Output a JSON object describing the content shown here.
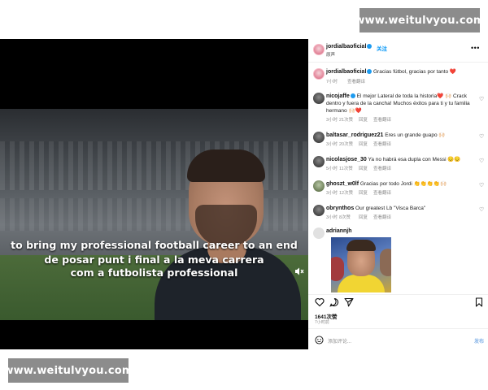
{
  "watermark": {
    "text": "www.weitulvyou.com"
  },
  "video": {
    "subtitle_en": "to bring my professional football career to an end",
    "subtitle_ca_1": "de posar punt i final a la meva carrera",
    "subtitle_ca_2": "com a futbolista professional"
  },
  "post": {
    "author": "jordialbaoficial",
    "follow_label": "关注",
    "header_subtitle": "原声",
    "caption": "Gracias fútbol, gracias por tanto ❤️",
    "caption_time": "7小时",
    "caption_translate": "查看翻译",
    "comments": [
      {
        "user": "nicojaffe",
        "text": "El mejor Lateral de toda la historia❤️ 🙌🏻 Crack dentro y fuera de la cancha! Muchos éxitos para ti y tu familia hermano 🙌🏻❤️",
        "time": "3小时",
        "likes": "21次赞",
        "reply": "回复",
        "translate": "查看翻译"
      },
      {
        "user": "baltasar_rodriguez21",
        "text": "Eres un grande guapo 🙌🏻",
        "time": "3小时",
        "likes": "20次赞",
        "reply": "回复",
        "translate": "查看翻译"
      },
      {
        "user": "nicolasjose_30",
        "text": "Ya no habrá esa dupla con Messi 😔😔",
        "time": "5小时",
        "likes": "11次赞",
        "reply": "回复",
        "translate": "查看翻译"
      },
      {
        "user": "ghoszt_w0lf",
        "text": "Gracias por todo Jordi 👏👏👏👏🙌🏻",
        "time": "3小时",
        "likes": "12次赞",
        "reply": "回复",
        "translate": "查看翻译"
      },
      {
        "user": "obrynthos",
        "text": "Our greatest Lb \"Visca Barca\"",
        "time": "3小时",
        "likes": "8次赞",
        "reply": "回复",
        "translate": "查看翻译"
      },
      {
        "user": "adriannjh",
        "text": "",
        "time": "",
        "likes": "",
        "reply": "",
        "translate": ""
      }
    ],
    "likes_count": "1641次赞",
    "date": "7小时前",
    "add_comment_placeholder": "添加评论...",
    "post_button": "发布"
  },
  "icons": {
    "more": "more-horizontal-icon",
    "like": "heart-icon",
    "comment": "comment-icon",
    "share": "send-icon",
    "save": "bookmark-icon",
    "emoji": "emoji-icon",
    "mute": "muted-speaker-icon"
  },
  "colors": {
    "link_blue": "#0095f6",
    "verified_blue": "#1d9bf0",
    "watermark_grey": "#8c8c8c"
  }
}
